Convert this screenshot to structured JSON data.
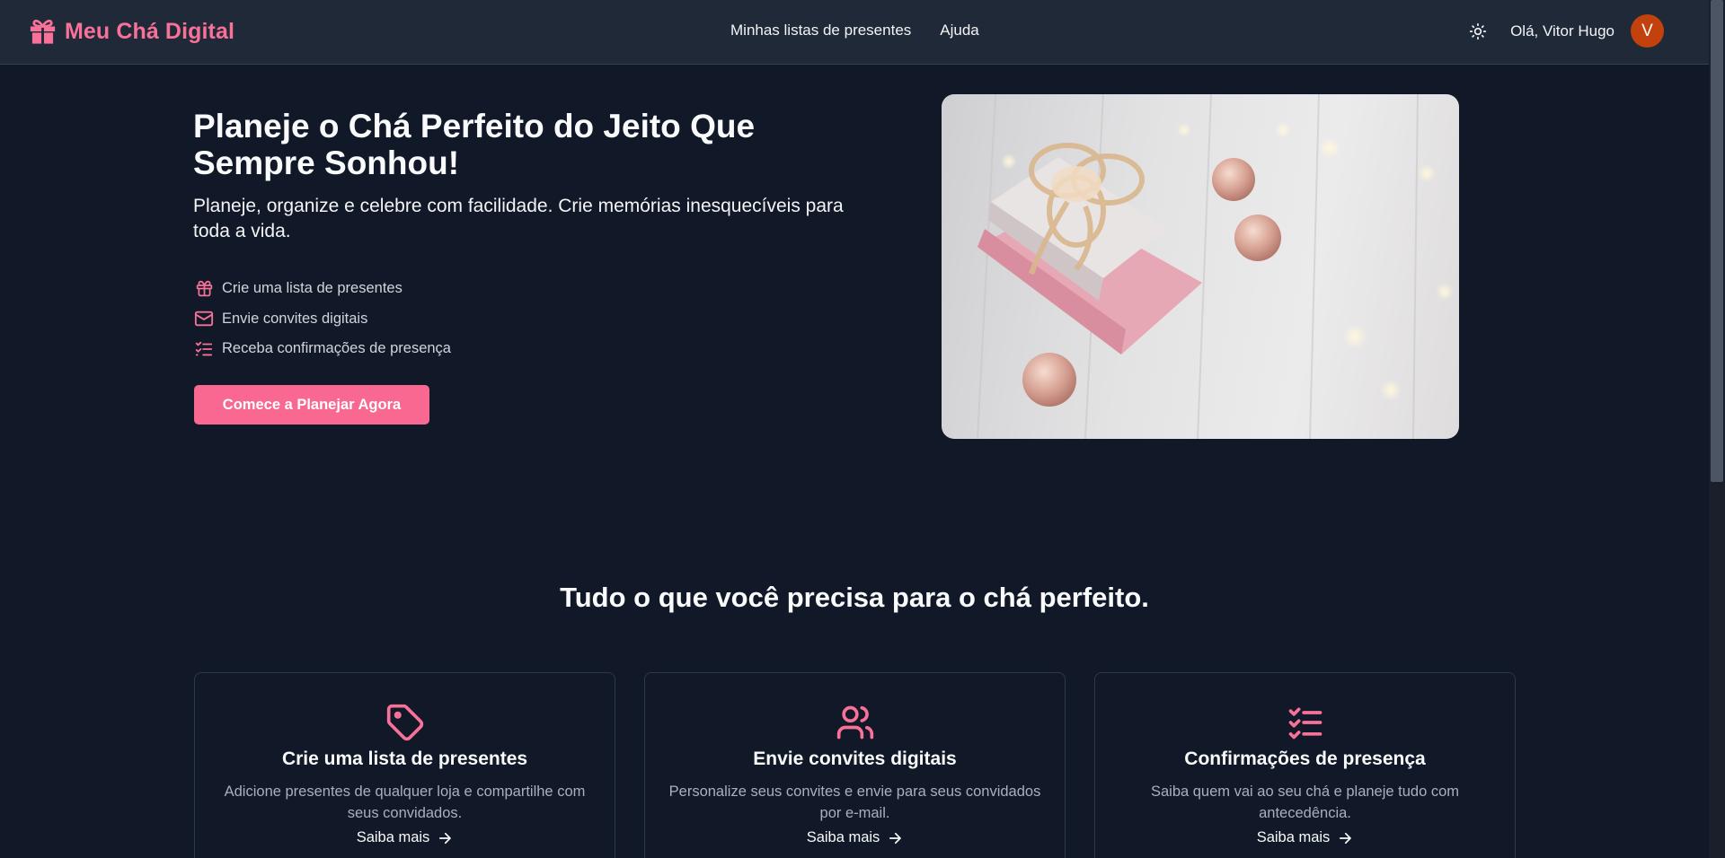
{
  "header": {
    "logo_text": "Meu Chá Digital",
    "nav": [
      "Minhas listas de presentes",
      "Ajuda"
    ],
    "greeting": "Olá, Vitor Hugo",
    "avatar_initial": "V"
  },
  "hero": {
    "title": "Planeje o Chá Perfeito do Jeito Que Sempre Sonhou!",
    "subtitle": "Planeje, organize e celebre com facilidade. Crie memórias inesquecíveis para toda a vida.",
    "features": [
      {
        "icon": "gift-icon",
        "label": "Crie uma lista de presentes"
      },
      {
        "icon": "mail-icon",
        "label": "Envie convites digitais"
      },
      {
        "icon": "list-check-icon",
        "label": "Receba confirmações de presença"
      }
    ],
    "cta_label": "Comece a Planejar Agora"
  },
  "features_section": {
    "title": "Tudo o que você precisa para o chá perfeito.",
    "cards": [
      {
        "icon": "tag-icon",
        "title": "Crie uma lista de presentes",
        "description": "Adicione presentes de qualquer loja e compartilhe com seus convidados.",
        "link": "Saiba mais"
      },
      {
        "icon": "users-icon",
        "title": "Envie convites digitais",
        "description": "Personalize seus convites e envie para seus convidados por e-mail.",
        "link": "Saiba mais"
      },
      {
        "icon": "list-check-icon",
        "title": "Confirmações de presença",
        "description": "Saiba quem vai ao seu chá e planeje tudo com antecedência.",
        "link": "Saiba mais"
      }
    ]
  },
  "colors": {
    "brand": "#f87198",
    "cta": "#f86891",
    "background": "#111827",
    "header": "#1f2937",
    "avatar": "#c2410c"
  }
}
